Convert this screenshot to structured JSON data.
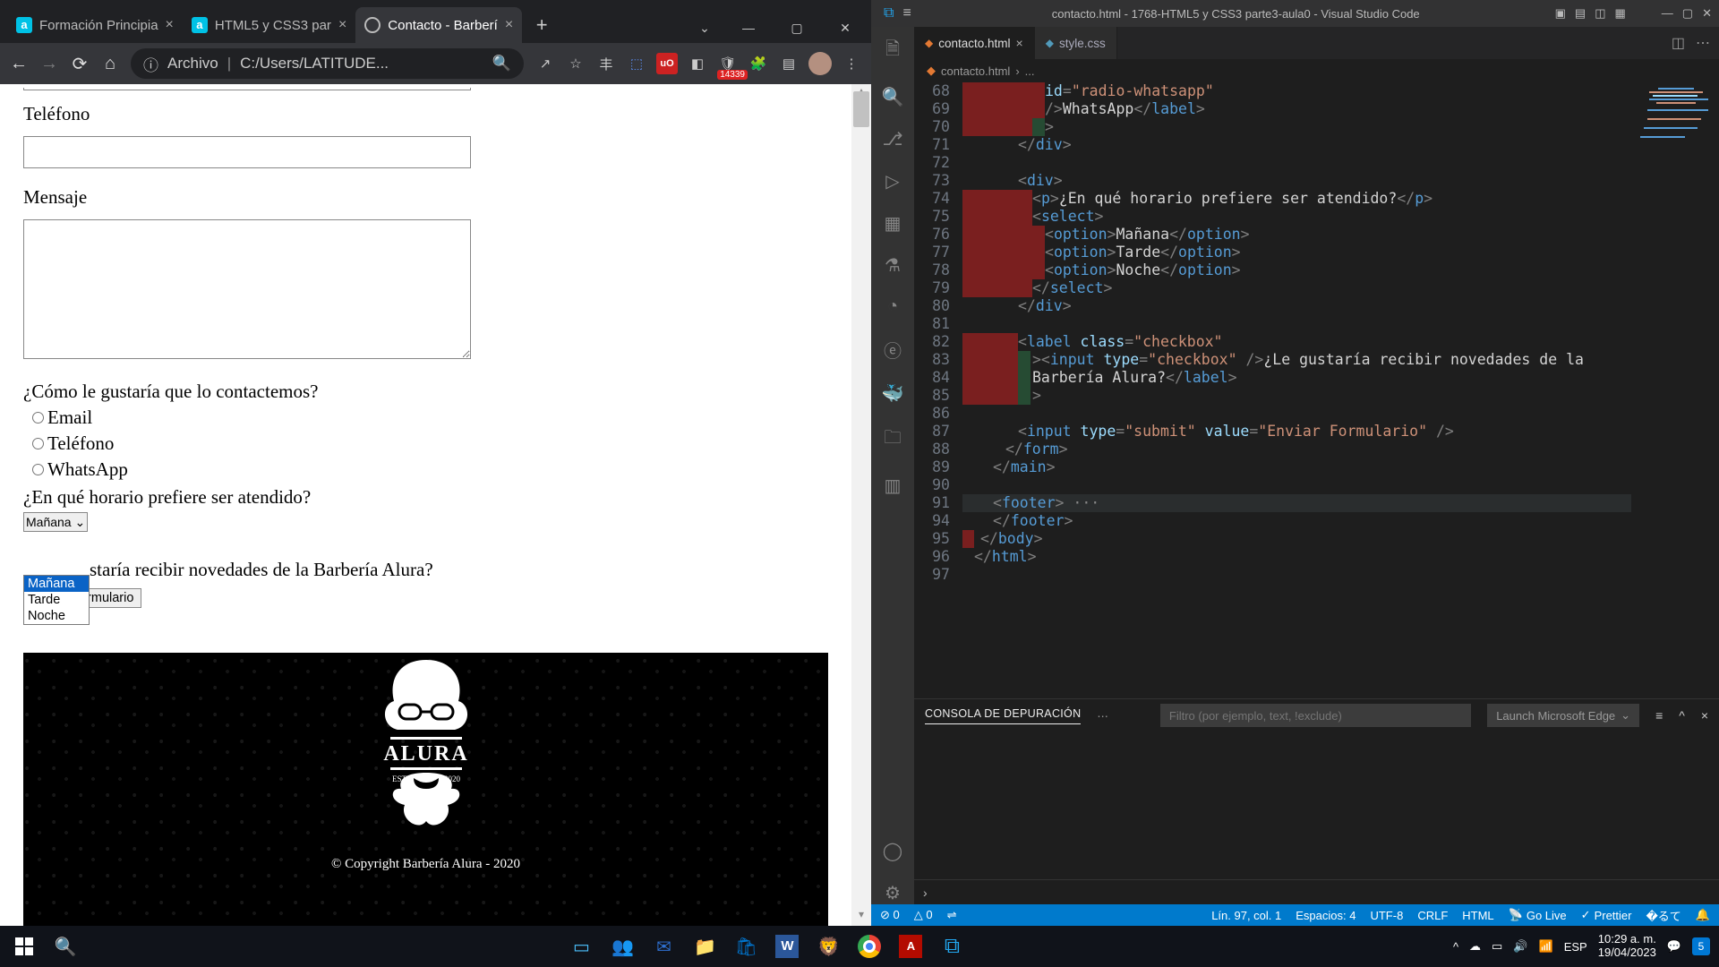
{
  "browser": {
    "tabs": [
      {
        "title": "Formación Principia",
        "favicon": "a"
      },
      {
        "title": "HTML5 y CSS3 par",
        "favicon": "a"
      },
      {
        "title": "Contacto - Barberí",
        "favicon": "globe",
        "active": true
      }
    ],
    "address": {
      "label": "Archivo",
      "path": "C:/Users/LATITUDE..."
    },
    "extension_badge": "14339"
  },
  "page": {
    "label_telefono": "Teléfono",
    "label_mensaje": "Mensaje",
    "q_contact": "¿Cómo le gustaría que lo contactemos?",
    "radio_email": "Email",
    "radio_telefono": "Teléfono",
    "radio_whatsapp": "WhatsApp",
    "q_schedule": "¿En qué horario prefiere ser atendido?",
    "select_value": "Mañana",
    "options": [
      "Mañana",
      "Tarde",
      "Noche"
    ],
    "cb_label_trail": "staría recibir novedades de la Barbería Alura?",
    "submit": "Enviar Formulario",
    "footer_brand": "ALURA",
    "footer_est": "ESTD",
    "footer_year": "2020",
    "copyright": "© Copyright Barbería Alura - 2020"
  },
  "vscode": {
    "title": "contacto.html - 1768-HTML5 y CSS3 parte3-aula0 - Visual Studio Code",
    "tabs": [
      {
        "name": "contacto.html",
        "active": true,
        "icon": "html"
      },
      {
        "name": "style.css",
        "active": false,
        "icon": "css"
      }
    ],
    "breadcrumbs": [
      "contacto.html",
      "..."
    ],
    "lines": [
      {
        "n": 68,
        "r": 92,
        "g": 0,
        "ind": 92,
        "html": "<span class='tk-attr'>id</span><span class='tk-brkt'>=</span><span class='tk-str'>\"radio-whatsapp\"</span>"
      },
      {
        "n": 69,
        "r": 92,
        "g": 0,
        "ind": 92,
        "html": "<span class='tk-brkt'>/&gt;</span><span class='tk-text'>WhatsApp</span><span class='tk-brkt'>&lt;/</span><span class='tk-tag'>label</span><span class='tk-brkt'>&gt;</span>"
      },
      {
        "n": 70,
        "r": 78,
        "g": 14,
        "ind": 92,
        "html": "<span class='tk-brkt'>&gt;</span>"
      },
      {
        "n": 71,
        "r": 0,
        "g": 0,
        "ind": 62,
        "html": "<span class='tk-brkt'>&lt;/</span><span class='tk-tag'>div</span><span class='tk-brkt'>&gt;</span>"
      },
      {
        "n": 72,
        "r": 0,
        "g": 0,
        "ind": 0,
        "html": ""
      },
      {
        "n": 73,
        "r": 0,
        "g": 0,
        "ind": 62,
        "html": "<span class='tk-brkt'>&lt;</span><span class='tk-tag'>div</span><span class='tk-brkt'>&gt;</span>"
      },
      {
        "n": 74,
        "r": 78,
        "g": 0,
        "ind": 78,
        "html": "<span class='tk-brkt'>&lt;</span><span class='tk-tag'>p</span><span class='tk-brkt'>&gt;</span><span class='tk-text'>¿En qué horario prefiere ser atendido?</span><span class='tk-brkt'>&lt;/</span><span class='tk-tag'>p</span><span class='tk-brkt'>&gt;</span>"
      },
      {
        "n": 75,
        "r": 78,
        "g": 0,
        "ind": 78,
        "html": "<span class='tk-brkt'>&lt;</span><span class='tk-tag'>select</span><span class='tk-brkt'>&gt;</span>"
      },
      {
        "n": 76,
        "r": 92,
        "g": 0,
        "ind": 92,
        "html": "<span class='tk-brkt'>&lt;</span><span class='tk-tag'>option</span><span class='tk-brkt'>&gt;</span><span class='tk-text'>Mañana</span><span class='tk-brkt'>&lt;/</span><span class='tk-tag'>option</span><span class='tk-brkt'>&gt;</span>"
      },
      {
        "n": 77,
        "r": 92,
        "g": 0,
        "ind": 92,
        "html": "<span class='tk-brkt'>&lt;</span><span class='tk-tag'>option</span><span class='tk-brkt'>&gt;</span><span class='tk-text'>Tarde</span><span class='tk-brkt'>&lt;/</span><span class='tk-tag'>option</span><span class='tk-brkt'>&gt;</span>"
      },
      {
        "n": 78,
        "r": 92,
        "g": 0,
        "ind": 92,
        "html": "<span class='tk-brkt'>&lt;</span><span class='tk-tag'>option</span><span class='tk-brkt'>&gt;</span><span class='tk-text'>Noche</span><span class='tk-brkt'>&lt;/</span><span class='tk-tag'>option</span><span class='tk-brkt'>&gt;</span>"
      },
      {
        "n": 79,
        "r": 78,
        "g": 0,
        "ind": 78,
        "html": "<span class='tk-brkt'>&lt;/</span><span class='tk-tag'>select</span><span class='tk-brkt'>&gt;</span>"
      },
      {
        "n": 80,
        "r": 0,
        "g": 0,
        "ind": 62,
        "html": "<span class='tk-brkt'>&lt;/</span><span class='tk-tag'>div</span><span class='tk-brkt'>&gt;</span>"
      },
      {
        "n": 81,
        "r": 0,
        "g": 0,
        "ind": 0,
        "html": ""
      },
      {
        "n": 82,
        "r": 62,
        "g": 0,
        "ind": 62,
        "html": "<span class='tk-brkt'>&lt;</span><span class='tk-tag'>label</span> <span class='tk-attr'>class</span><span class='tk-brkt'>=</span><span class='tk-str'>\"checkbox\"</span>"
      },
      {
        "n": 83,
        "r": 62,
        "g": 14,
        "ind": 78,
        "html": "<span class='tk-brkt'>&gt;&lt;</span><span class='tk-tag'>input</span> <span class='tk-attr'>type</span><span class='tk-brkt'>=</span><span class='tk-str'>\"checkbox\"</span> <span class='tk-brkt'>/&gt;</span><span class='tk-text'>¿Le gustaría recibir novedades de la</span>"
      },
      {
        "n": 84,
        "r": 62,
        "g": 14,
        "ind": 78,
        "html": "<span class='tk-text'>Barbería Alura?</span><span class='tk-brkt'>&lt;/</span><span class='tk-tag'>label</span><span class='tk-brkt'>&gt;</span>"
      },
      {
        "n": 85,
        "r": 62,
        "g": 14,
        "ind": 78,
        "html": "<span class='tk-brkt'>&gt;</span>"
      },
      {
        "n": 86,
        "r": 0,
        "g": 0,
        "ind": 0,
        "html": ""
      },
      {
        "n": 87,
        "r": 0,
        "g": 0,
        "ind": 62,
        "html": "<span class='tk-brkt'>&lt;</span><span class='tk-tag'>input</span> <span class='tk-attr'>type</span><span class='tk-brkt'>=</span><span class='tk-str'>\"submit\"</span> <span class='tk-attr'>value</span><span class='tk-brkt'>=</span><span class='tk-str'>\"Enviar Formulario\"</span> <span class='tk-brkt'>/&gt;</span>"
      },
      {
        "n": 88,
        "r": 0,
        "g": 0,
        "ind": 48,
        "html": "<span class='tk-brkt'>&lt;/</span><span class='tk-tag'>form</span><span class='tk-brkt'>&gt;</span>"
      },
      {
        "n": 89,
        "r": 0,
        "g": 0,
        "ind": 34,
        "html": "<span class='tk-brkt'>&lt;/</span><span class='tk-tag'>main</span><span class='tk-brkt'>&gt;</span>"
      },
      {
        "n": 90,
        "r": 0,
        "g": 0,
        "ind": 0,
        "html": ""
      },
      {
        "n": 91,
        "r": 0,
        "g": 0,
        "ind": 34,
        "fold": true,
        "highlight": true,
        "html": "<span class='tk-brkt'>&lt;</span><span class='tk-tag'>footer</span><span class='tk-brkt'>&gt;</span><span class='dots'> ···</span>"
      },
      {
        "n": 94,
        "r": 0,
        "g": 0,
        "ind": 34,
        "html": "<span class='tk-brkt'>&lt;/</span><span class='tk-tag'>footer</span><span class='tk-brkt'>&gt;</span>"
      },
      {
        "n": 95,
        "r": 13,
        "g": 0,
        "ind": 20,
        "html": "<span class='tk-brkt'>&lt;/</span><span class='tk-tag'>body</span><span class='tk-brkt'>&gt;</span>"
      },
      {
        "n": 96,
        "r": 0,
        "g": 0,
        "ind": 13,
        "html": "<span class='tk-brkt'>&lt;/</span><span class='tk-tag'>html</span><span class='tk-brkt'>&gt;</span>"
      },
      {
        "n": 97,
        "r": 0,
        "g": 0,
        "ind": 13,
        "html": ""
      }
    ],
    "debug_panel": {
      "tab": "CONSOLA DE DEPURACIÓN",
      "filter_placeholder": "Filtro (por ejemplo, text, !exclude)",
      "launch": "Launch Microsoft Edge"
    },
    "status": {
      "errors": "⊘ 0",
      "warnings": "△ 0",
      "port": "⇌",
      "ln_col": "Lín. 97, col. 1",
      "spaces": "Espacios: 4",
      "encoding": "UTF-8",
      "eol": "CRLF",
      "lang": "HTML",
      "golive": "Go Live",
      "prettier": "Prettier"
    }
  },
  "taskbar": {
    "time_1": "10:29 a. m.",
    "time_2": "19/04/2023",
    "lang": "ESP",
    "notif": "5"
  }
}
